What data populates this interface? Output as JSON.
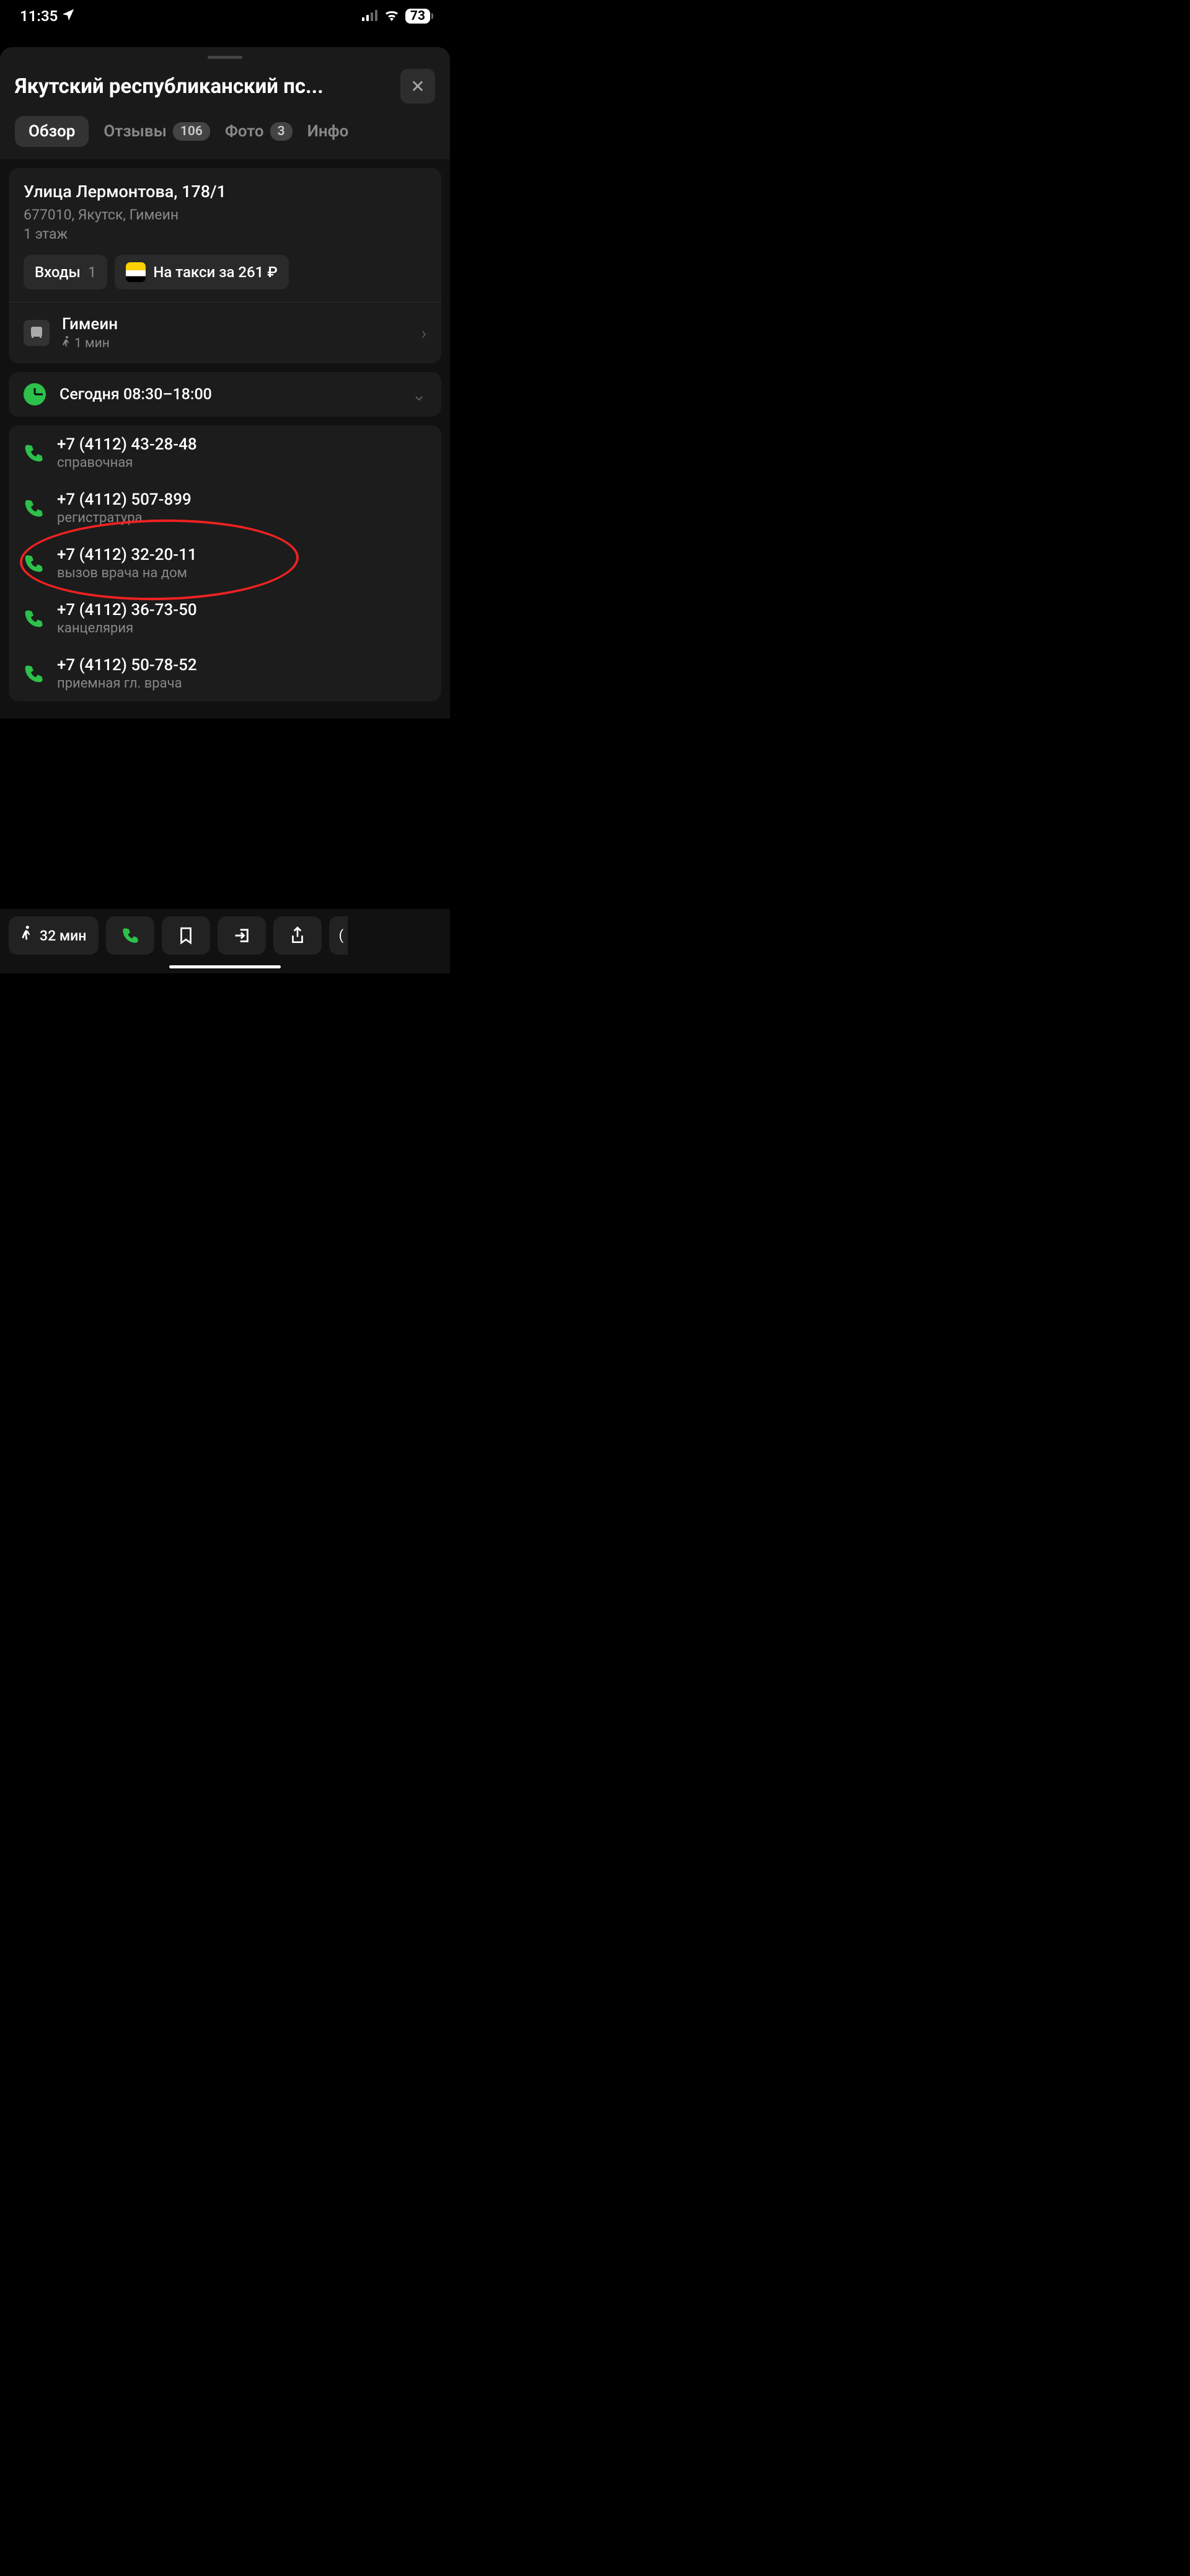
{
  "status": {
    "time": "11:35",
    "battery": "73"
  },
  "header": {
    "title": "Якутский республиканский пс..."
  },
  "tabs": {
    "overview": "Обзор",
    "reviews": {
      "label": "Отзывы",
      "count": "106"
    },
    "photos": {
      "label": "Фото",
      "count": "3"
    },
    "info": "Инфо"
  },
  "address": {
    "street": "Улица Лермонтова, 178/1",
    "city": "677010, Якутск, Гимеин",
    "floor": "1 этаж",
    "entrances": {
      "label": "Входы",
      "count": "1"
    },
    "taxi": "На такси за 261 ₽"
  },
  "transit": {
    "name": "Гимеин",
    "walk": "1 мин"
  },
  "hours": "Сегодня 08:30–18:00",
  "phones": [
    {
      "number": "+7 (4112) 43-28-48",
      "label": "справочная"
    },
    {
      "number": "+7 (4112) 507-899",
      "label": "регистратура"
    },
    {
      "number": "+7 (4112) 32-20-11",
      "label": "вызов врача на дом"
    },
    {
      "number": "+7 (4112) 36-73-50",
      "label": "канцелярия"
    },
    {
      "number": "+7 (4112) 50-78-52",
      "label": "приемная гл. врача"
    }
  ],
  "bottom": {
    "walk": "32 мин"
  }
}
